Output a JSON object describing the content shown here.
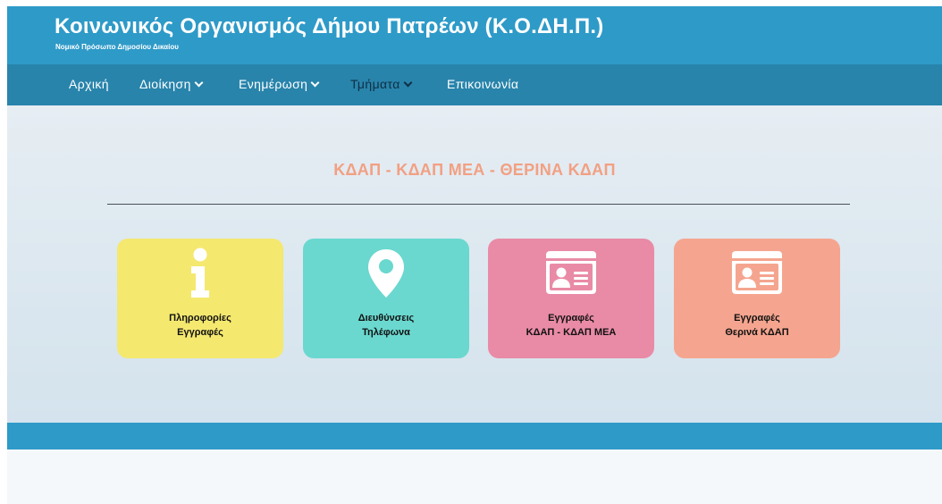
{
  "header": {
    "title": "Κοινωνικός Οργανισμός Δήμου Πατρέων (Κ.Ο.ΔΗ.Π.)",
    "subtitle": "Νομικό Πρόσωπο Δημοσίου Δικαίου"
  },
  "nav": {
    "items": [
      {
        "label": "Αρχική"
      },
      {
        "label": "Διοίκηση"
      },
      {
        "label": "Ενημέρωση"
      },
      {
        "label": "Τμήματα"
      },
      {
        "label": "Επικοινωνία"
      }
    ]
  },
  "main": {
    "section_title": "ΚΔΑΠ - ΚΔΑΠ ΜΕΑ - ΘΕΡΙΝΑ ΚΔΑΠ",
    "cards": [
      {
        "icon": "info-icon",
        "color": "#f4e86f",
        "line1": "Πληροφορίες",
        "line2": "Εγγραφές"
      },
      {
        "icon": "map-marker-icon",
        "color": "#6ad8cf",
        "line1": "Διευθύνσεις",
        "line2": "Τηλέφωνα"
      },
      {
        "icon": "id-card-icon",
        "color": "#e98ba6",
        "line1": "Εγγραφές",
        "line2": "ΚΔΑΠ - ΚΔΑΠ ΜΕΑ"
      },
      {
        "icon": "id-card-icon",
        "color": "#f5a58f",
        "line1": "Εγγραφές",
        "line2": "Θερινά ΚΔΑΠ"
      }
    ]
  },
  "colors": {
    "header": "#2e9ac8",
    "navbar": "#2884ab",
    "section_title": "#f2a083"
  }
}
